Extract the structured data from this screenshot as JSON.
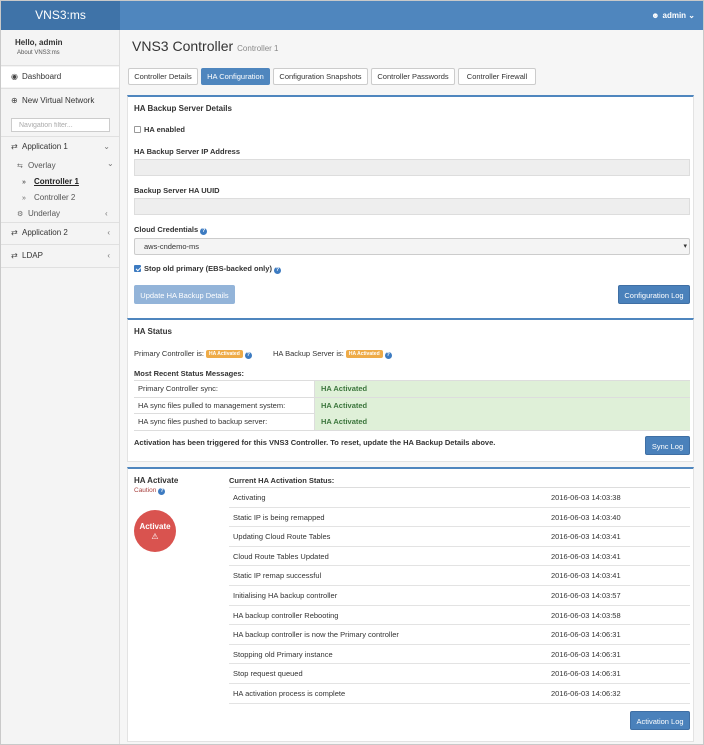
{
  "header": {
    "brand": "VNS3:ms",
    "user": "admin",
    "caret": "⌄"
  },
  "sidebar": {
    "hello": "Hello, admin",
    "about": "About VNS3:ms",
    "dashboard": "Dashboard",
    "new_vnet": "New Virtual Network",
    "filter_placeholder": "Navigation filter...",
    "application1": "Application 1",
    "overlay": "Overlay",
    "controller1": "Controller 1",
    "controller2": "Controller 2",
    "underlay": "Underlay",
    "application2": "Application 2",
    "ldap": "LDAP"
  },
  "page": {
    "title": "VNS3 Controller",
    "subtitle": "Controller 1"
  },
  "tabs": [
    "Controller Details",
    "HA Configuration",
    "Configuration Snapshots",
    "Controller Passwords",
    "Controller Firewall"
  ],
  "backup": {
    "title": "HA Backup Server Details",
    "ha_enabled": "HA enabled",
    "ip_label": "HA Backup Server IP Address",
    "ip_value": "",
    "uuid_label": "Backup Server HA UUID",
    "uuid_value": "",
    "cred_label": "Cloud Credentials",
    "cred_value": "aws-cndemo-ms",
    "stop_old": "Stop old primary (EBS-backed only)",
    "update_btn": "Update HA Backup Details",
    "config_log_btn": "Configuration Log"
  },
  "status": {
    "title": "HA Status",
    "primary_label": "Primary Controller is:",
    "primary_badge": "HA Activated",
    "backup_label": "HA Backup Server is:",
    "backup_badge": "HA Activated",
    "recent_title": "Most Recent Status Messages:",
    "rows": [
      {
        "k": "Primary Controller sync:",
        "v": "HA Activated"
      },
      {
        "k": "HA sync files pulled to management system:",
        "v": "HA Activated"
      },
      {
        "k": "HA sync files pushed to backup server:",
        "v": "HA Activated"
      }
    ],
    "note": "Activation has been triggered for this VNS3 Controller. To reset, update the HA Backup Details above.",
    "sync_log_btn": "Sync Log"
  },
  "activate": {
    "title": "HA Activate",
    "caution": "Caution",
    "button": "Activate",
    "warn_glyph": "⚠",
    "current_title": "Current HA Activation Status:",
    "rows": [
      {
        "m": "Activating",
        "d": "2016-06-03 14:03:38"
      },
      {
        "m": "Static IP is being remapped",
        "d": "2016-06-03 14:03:40"
      },
      {
        "m": "Updating Cloud Route Tables",
        "d": "2016-06-03 14:03:41"
      },
      {
        "m": "Cloud Route Tables Updated",
        "d": "2016-06-03 14:03:41"
      },
      {
        "m": "Static IP remap successful",
        "d": "2016-06-03 14:03:41"
      },
      {
        "m": "Initialising HA backup controller",
        "d": "2016-06-03 14:03:57"
      },
      {
        "m": "HA backup controller Rebooting",
        "d": "2016-06-03 14:03:58"
      },
      {
        "m": "HA backup controller is now the Primary controller",
        "d": "2016-06-03 14:06:31"
      },
      {
        "m": "Stopping old Primary instance",
        "d": "2016-06-03 14:06:31"
      },
      {
        "m": "Stop request queued",
        "d": "2016-06-03 14:06:31"
      },
      {
        "m": "HA activation process is complete",
        "d": "2016-06-03 14:06:32"
      }
    ],
    "log_btn": "Activation Log"
  },
  "colors": {
    "header": "#4f86be",
    "brand": "#3f73a8",
    "primary_btn": "#4a81bb",
    "badge": "#eeab48",
    "danger": "#d9534f",
    "success_bg": "#dff0d8",
    "success_text": "#3c763d"
  },
  "icons": {
    "user": "user-icon",
    "dashboard": "dashboard-icon",
    "plus": "plus-circle-icon",
    "shuffle": "shuffle-icon",
    "cogs": "cogs-icon",
    "help": "question-circle-icon",
    "warning": "warning-icon"
  }
}
